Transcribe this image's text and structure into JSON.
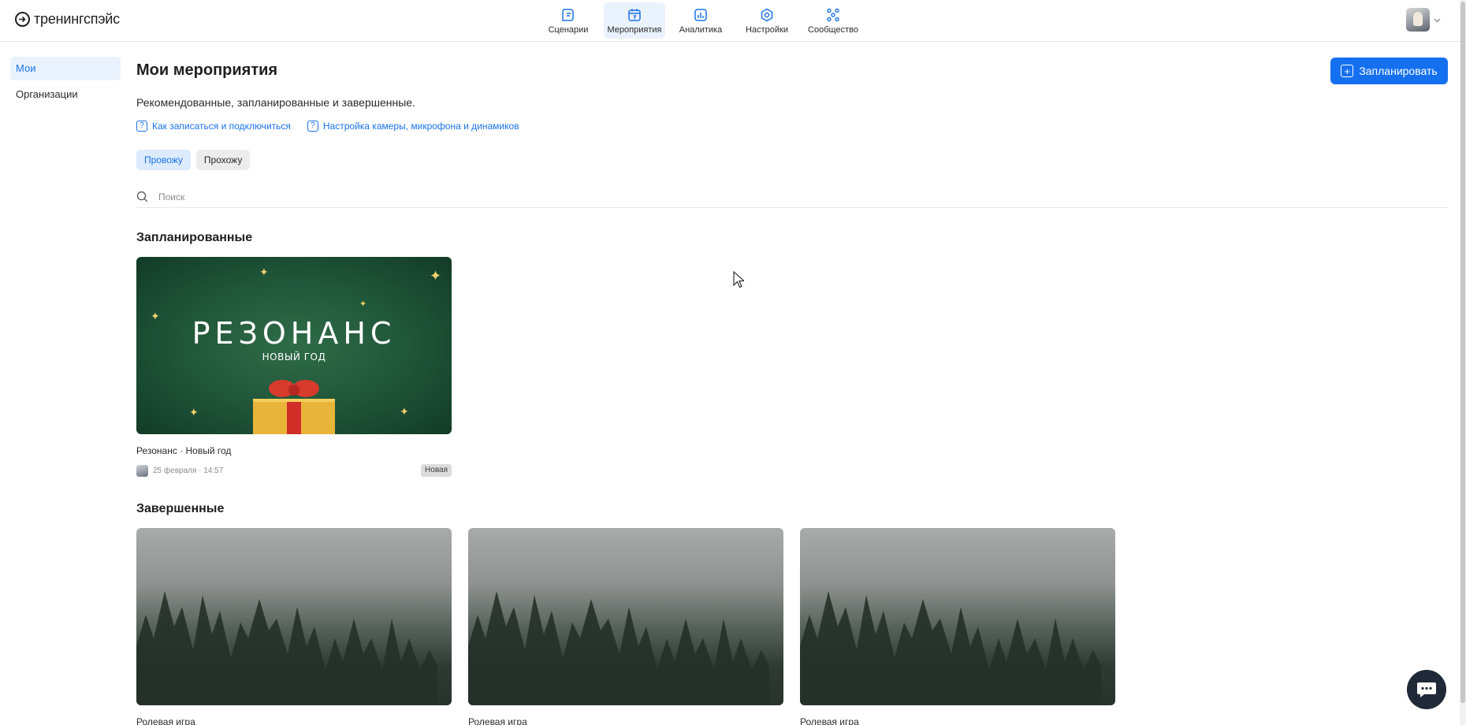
{
  "header": {
    "logo_text": "тренингспэйс",
    "nav": [
      {
        "label": "Сценарии",
        "icon": "scenarios-icon",
        "active": false
      },
      {
        "label": "Мероприятия",
        "icon": "calendar-icon",
        "active": true
      },
      {
        "label": "Аналитика",
        "icon": "analytics-icon",
        "active": false
      },
      {
        "label": "Настройки",
        "icon": "settings-icon",
        "active": false
      },
      {
        "label": "Сообщество",
        "icon": "community-icon",
        "active": false
      }
    ]
  },
  "sidebar": {
    "items": [
      {
        "label": "Мои",
        "active": true
      },
      {
        "label": "Организации",
        "active": false
      }
    ]
  },
  "main": {
    "title": "Мои мероприятия",
    "plan_button": "Запланировать",
    "subtitle": "Рекомендованные, запланированные и завершенные.",
    "help_links": [
      "Как записаться и подключиться",
      "Настройка камеры, микрофона и динамиков"
    ],
    "chips": [
      {
        "label": "Провожу",
        "active": true
      },
      {
        "label": "Прохожу",
        "active": false
      }
    ],
    "search_placeholder": "Поиск",
    "scheduled": {
      "title": "Запланированные",
      "cards": [
        {
          "title": "Резонанс · Новый год",
          "date": "25 февраля · 14:57",
          "badge": "Новая",
          "cover_title": "РЕЗОНАНС",
          "cover_subtitle": "НОВЫЙ ГОД"
        }
      ]
    },
    "completed": {
      "title": "Завершенные",
      "cards": [
        {
          "title": "Ролевая игра"
        },
        {
          "title": "Ролевая игра"
        },
        {
          "title": "Ролевая игра"
        }
      ]
    }
  },
  "colors": {
    "accent": "#1570ef",
    "active_bg": "#eaf2fd",
    "chat_button": "#1f2937"
  }
}
